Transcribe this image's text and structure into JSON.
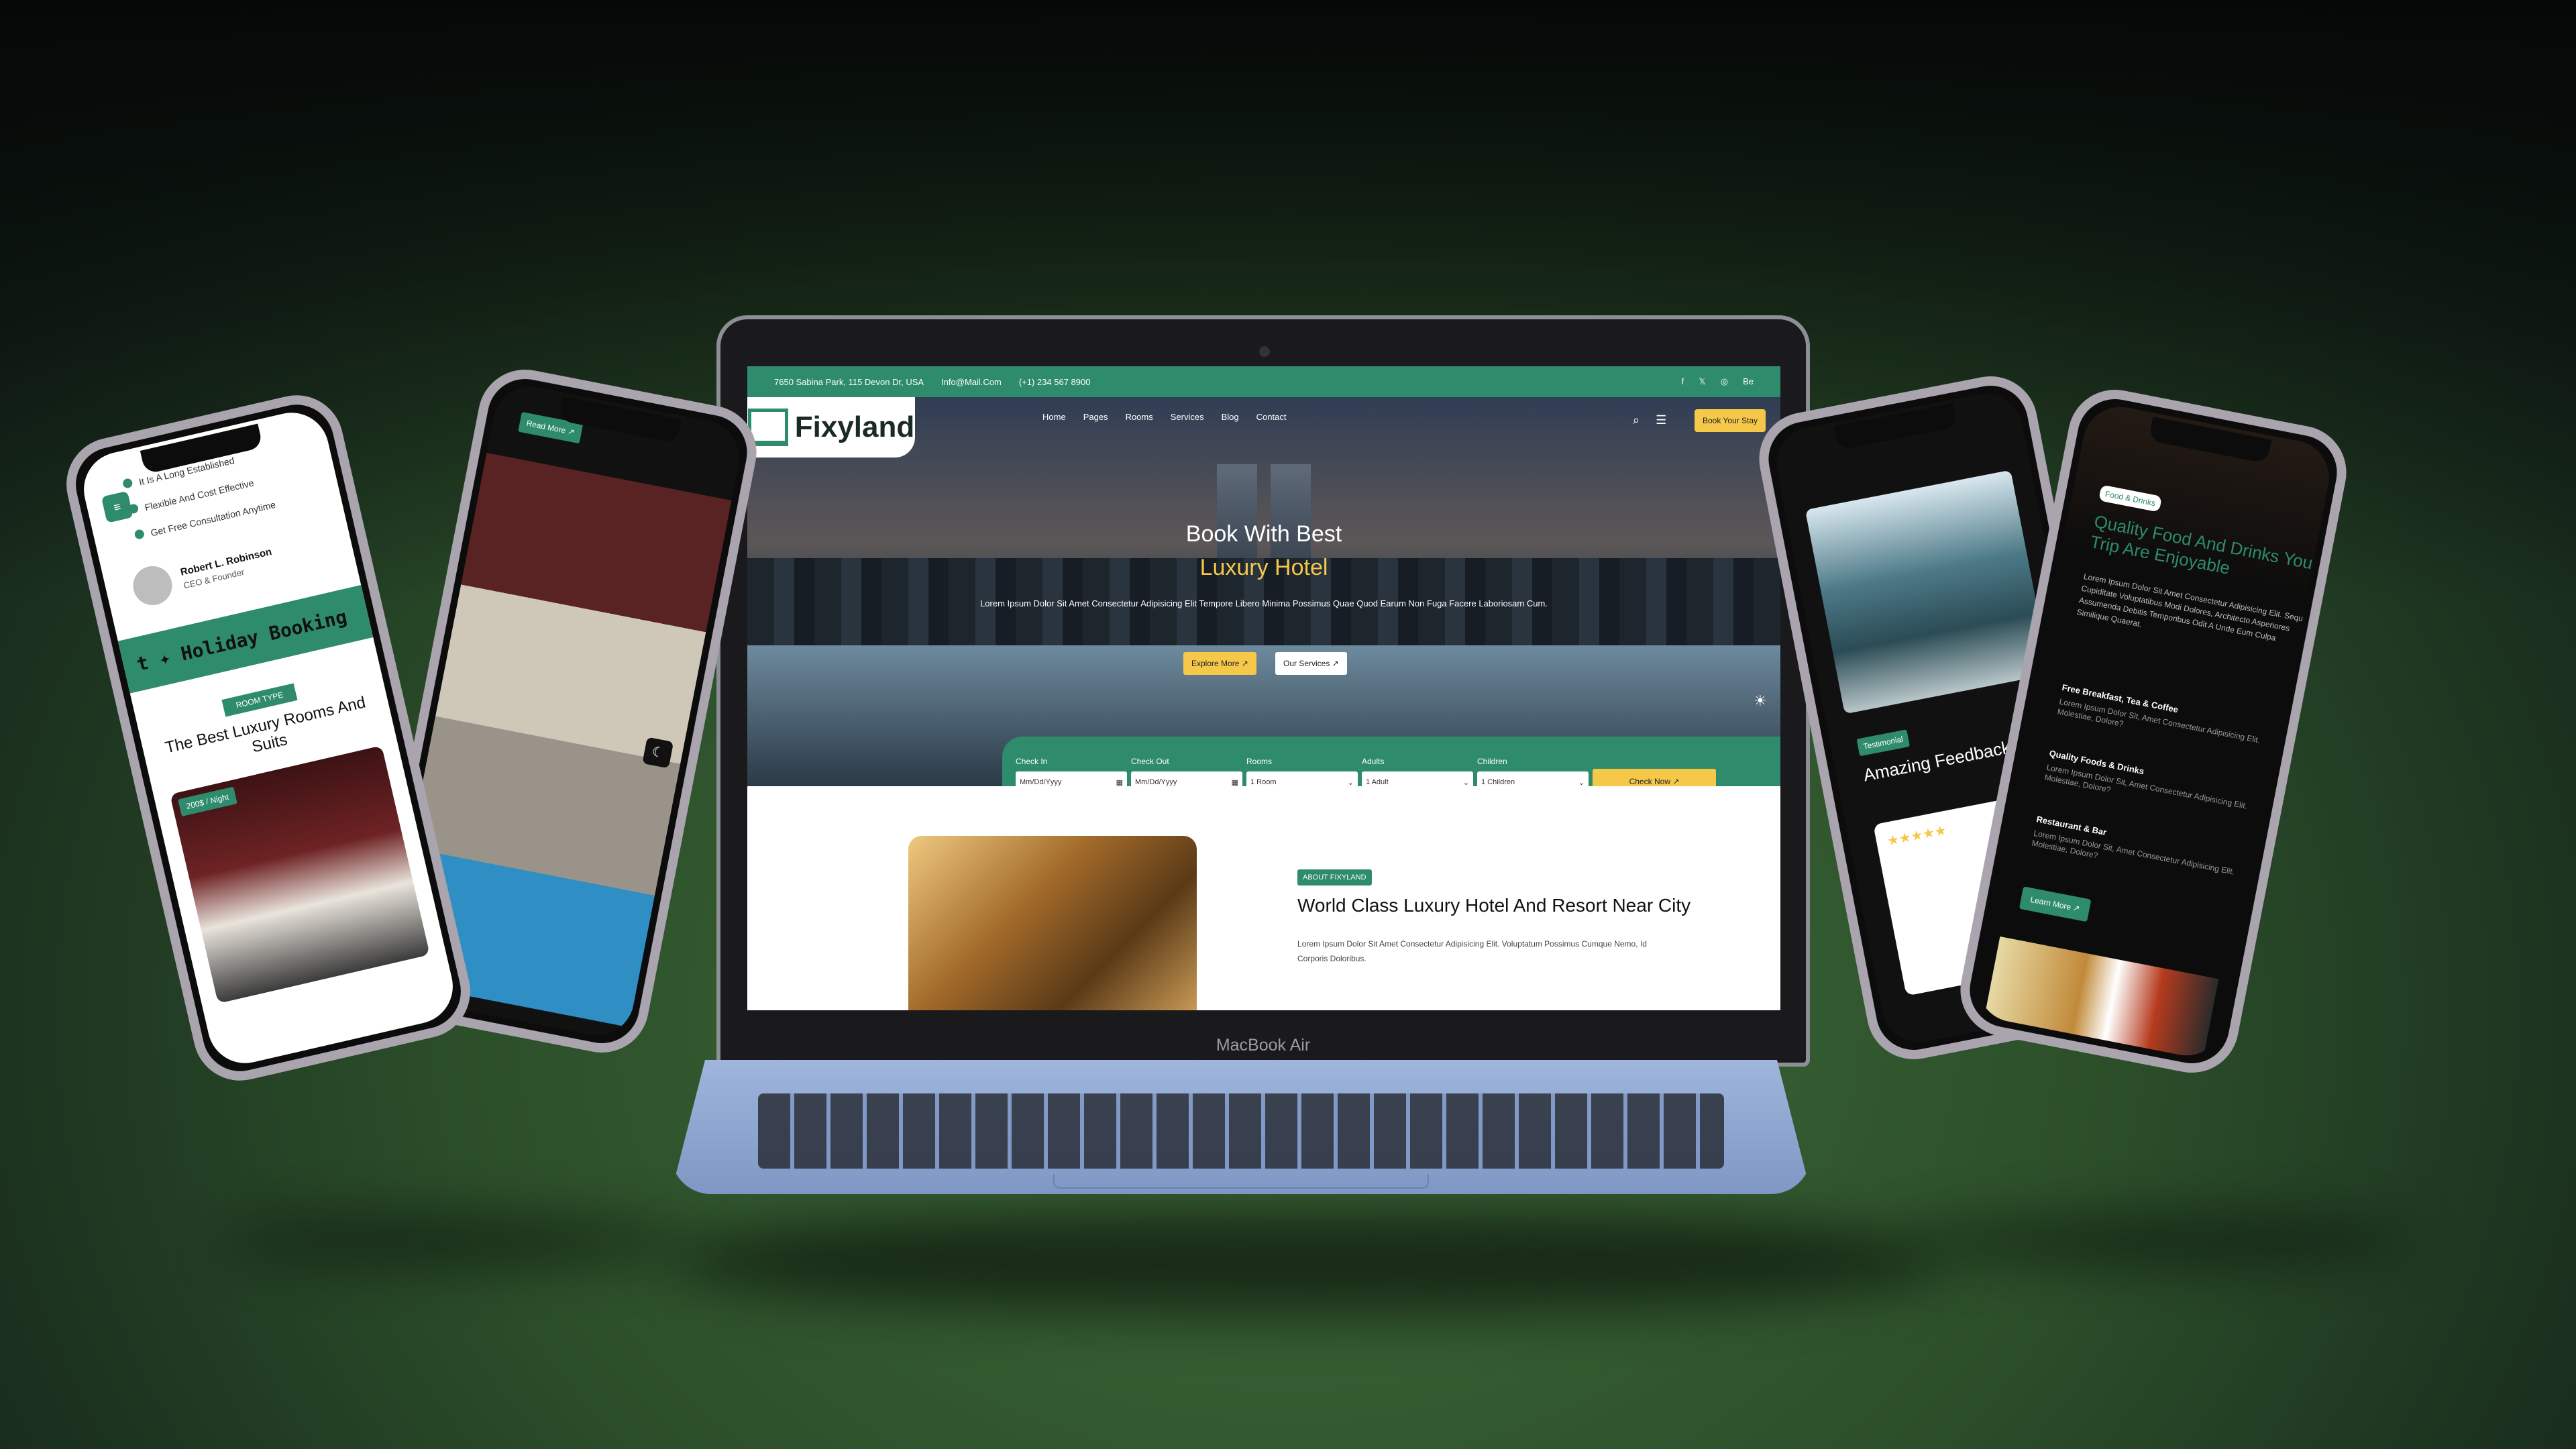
{
  "site": {
    "brand": "Fixyland",
    "topbar": {
      "address": "7650 Sabina Park, 115 Devon Dr, USA",
      "email": "Info@Mail.Com",
      "phone": "(+1) 234 567 8900"
    },
    "nav": [
      "Home",
      "Pages",
      "Rooms",
      "Services",
      "Blog",
      "Contact"
    ],
    "book_btn": "Book Your Stay",
    "hero": {
      "title_line1": "Book With Best",
      "title_line2": "Luxury Hotel",
      "text": "Lorem Ipsum Dolor Sit Amet Consectetur Adipisicing Elit Tempore Libero Minima Possimus Quae Quod Earum Non Fuga Facere Laboriosam Cum.",
      "btn_explore": "Explore More ↗",
      "btn_services": "Our Services ↗"
    },
    "booking": {
      "check_in_label": "Check In",
      "check_out_label": "Check Out",
      "rooms_label": "Rooms",
      "adults_label": "Adults",
      "children_label": "Children",
      "date_placeholder": "Mm/Dd/Yyyy",
      "rooms_value": "1 Room",
      "adults_value": "1 Adult",
      "children_value": "1 Children",
      "check_btn": "Check Now ↗"
    },
    "about": {
      "tag": "ABOUT FIXYLAND",
      "title": "World Class Luxury Hotel And Resort Near City",
      "text": "Lorem Ipsum Dolor Sit Amet Consectetur Adipisicing Elit. Voluptatum Possimus Cumque Nemo, Id Corporis Doloribus."
    }
  },
  "device_label": "MacBook Air",
  "phone_left": {
    "items": [
      "It Is A Long Established",
      "Flexible And Cost Effective",
      "Get Free Consultation Anytime"
    ],
    "author_name": "Robert L. Robinson",
    "author_role": "CEO & Founder",
    "marquee": "t ✦ Holiday Booking",
    "room_tag": "ROOM TYPE",
    "room_title": "The Best Luxury Rooms And Suits",
    "price": "200$ / Night"
  },
  "phone_left2": {
    "read_more": "Read More ↗"
  },
  "phone_right1": {
    "tag": "Testimonial",
    "title": "Amazing Feedback Service"
  },
  "phone_right2": {
    "tag": "Food & Drinks",
    "title": "Quality Food And Drinks Your Trip Are Enjoyable",
    "text": "Lorem Ipsum Dolor Sit Amet Consectetur Adipisicing Elit. Sequi Cupiditate Voluptatibus Modi Dolores, Architecto Asperiores Assumenda Debitis Temporibus Odit A Unde Eum Culpa Similique Quaerat.",
    "item1_title": "Free Breakfast, Tea & Coffee",
    "item1_text": "Lorem Ipsum Dolor Sit, Amet Consectetur Adipisicing Elit. Molestiae, Dolore?",
    "item2_title": "Quality Foods & Drinks",
    "item2_text": "Lorem Ipsum Dolor Sit, Amet Consectetur Adipisicing Elit. Molestiae, Dolore?",
    "item3_title": "Restaurant & Bar",
    "item3_text": "Lorem Ipsum Dolor Sit, Amet Consectetur Adipisicing Elit. Molestiae, Dolore?",
    "learn_more": "Learn More ↗"
  },
  "colors": {
    "accent": "#2e8b6b",
    "gold": "#f5c84a"
  }
}
